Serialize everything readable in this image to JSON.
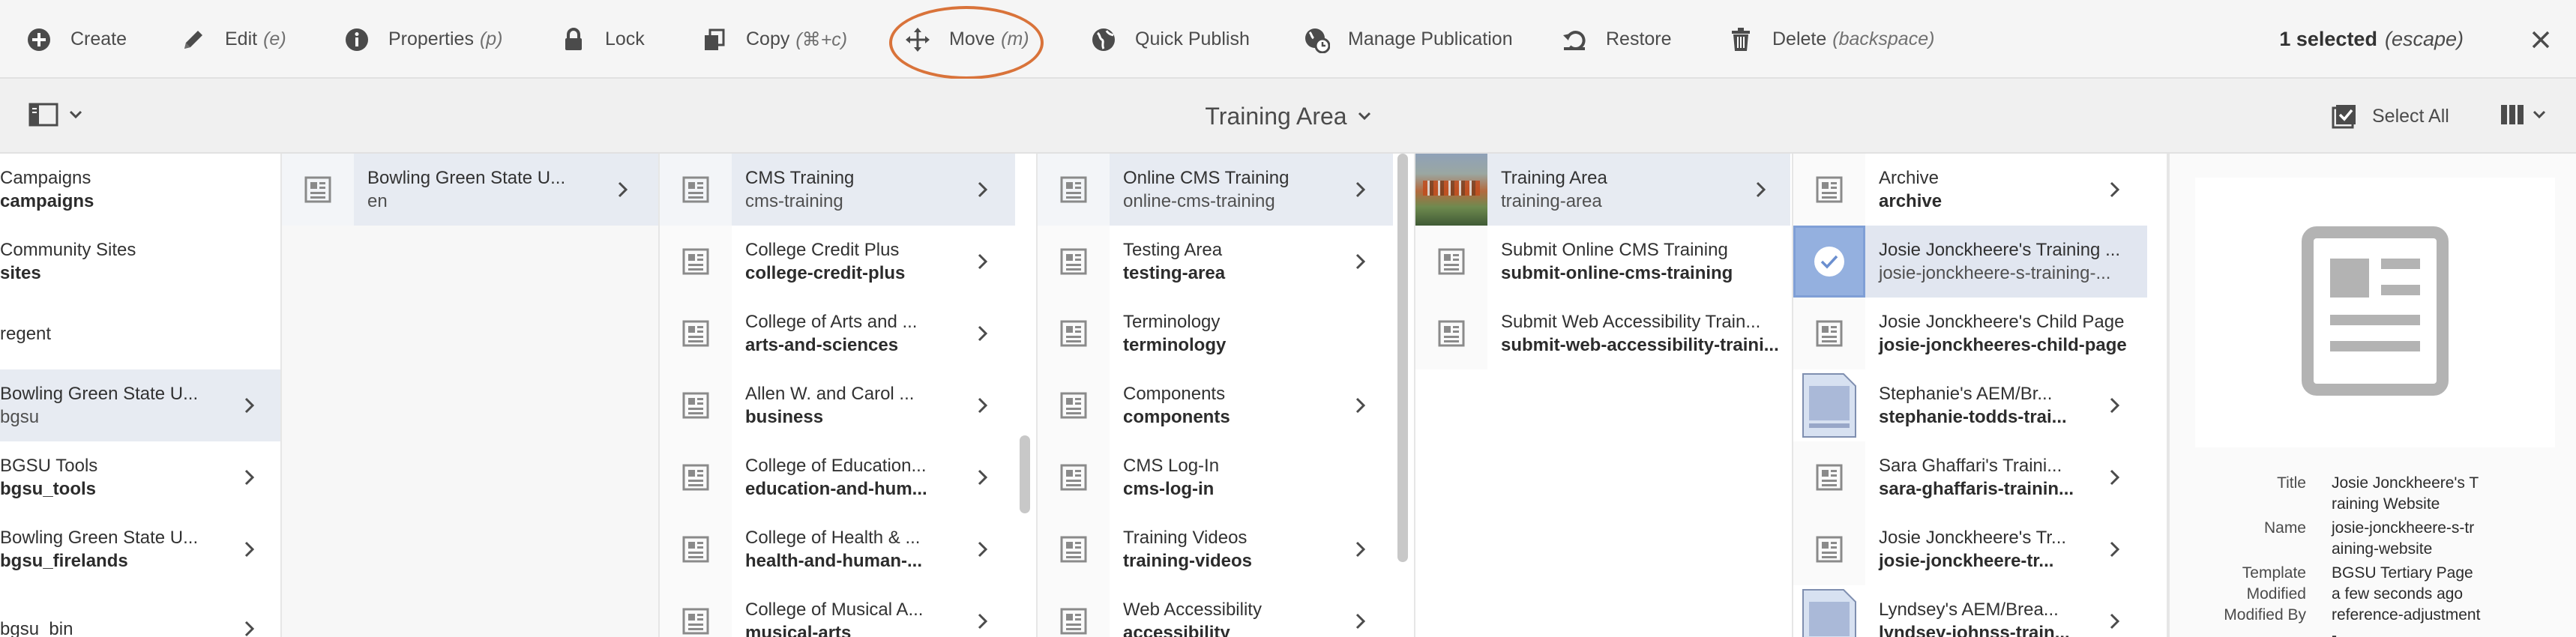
{
  "actions": {
    "create": "Create",
    "edit": "Edit",
    "edit_shortcut": "(e)",
    "properties": "Properties",
    "properties_shortcut": "(p)",
    "lock": "Lock",
    "copy": "Copy",
    "copy_shortcut": "(⌘+c)",
    "move": "Move",
    "move_shortcut": "(m)",
    "quick_publish": "Quick Publish",
    "manage_publication": "Manage Publication",
    "restore": "Restore",
    "delete": "Delete",
    "delete_shortcut": "(backspace)"
  },
  "selection": {
    "count": "1 selected",
    "shortcut": "(escape)"
  },
  "titlebar": {
    "title": "Training Area",
    "select_all": "Select All"
  },
  "columns": {
    "c1": [
      {
        "t1": "Campaigns",
        "t2": "campaigns",
        "chevron": false
      },
      {
        "t1": "Community Sites",
        "t2": "sites",
        "chevron": false
      },
      {
        "t1": "regent",
        "t2": "",
        "chevron": false
      },
      {
        "t1": "Bowling Green State U...",
        "t2": "bgsu",
        "chevron": true,
        "active": true
      },
      {
        "t1": "BGSU Tools",
        "t2": "bgsu_tools",
        "chevron": true
      },
      {
        "t1": "Bowling Green State U...",
        "t2": "bgsu_firelands",
        "chevron": true
      },
      {
        "t1": "bgsu_bin",
        "t2": "",
        "chevron": true
      }
    ],
    "c2": [
      {
        "t1": "Bowling Green State U...",
        "t2": "en",
        "chevron": true,
        "active": true
      }
    ],
    "c3": [
      {
        "t1": "CMS Training",
        "t2": "cms-training",
        "chevron": true,
        "active": true
      },
      {
        "t1": "College Credit Plus",
        "t2": "college-credit-plus",
        "chevron": true
      },
      {
        "t1": "College of Arts and ...",
        "t2": "arts-and-sciences",
        "chevron": true
      },
      {
        "t1": "Allen W. and Carol ...",
        "t2": "business",
        "chevron": true
      },
      {
        "t1": "College of Education...",
        "t2": "education-and-hum...",
        "chevron": true
      },
      {
        "t1": "College of Health & ...",
        "t2": "health-and-human-...",
        "chevron": true
      },
      {
        "t1": "College of Musical A...",
        "t2": "musical-arts",
        "chevron": true
      }
    ],
    "c4": [
      {
        "t1": "Online CMS Training",
        "t2": "online-cms-training",
        "chevron": true,
        "active": true
      },
      {
        "t1": "Testing Area",
        "t2": "testing-area",
        "chevron": true
      },
      {
        "t1": "Terminology",
        "t2": "terminology",
        "chevron": false
      },
      {
        "t1": "Components",
        "t2": "components",
        "chevron": true
      },
      {
        "t1": "CMS Log-In",
        "t2": "cms-log-in",
        "chevron": false
      },
      {
        "t1": "Training Videos",
        "t2": "training-videos",
        "chevron": true
      },
      {
        "t1": "Web Accessibility",
        "t2": "accessibility",
        "chevron": true
      }
    ],
    "c5": [
      {
        "t1": "Training Area",
        "t2": "training-area",
        "chevron": true,
        "active": true,
        "thumb": "photo"
      },
      {
        "t1": "Submit Online CMS Training",
        "t2": "submit-online-cms-training",
        "chevron": false
      },
      {
        "t1": "Submit Web Accessibility Train...",
        "t2": "submit-web-accessibility-traini...",
        "chevron": false
      }
    ],
    "c6": [
      {
        "t1": "Archive",
        "t2": "archive",
        "chevron": true
      },
      {
        "t1": "Josie Jonckheere's Training ...",
        "t2": "josie-jonckheere-s-training-...",
        "chevron": false,
        "selected": true,
        "thumb": "check"
      },
      {
        "t1": "Josie Jonckheere's Child Page",
        "t2": "josie-jonckheeres-child-page",
        "chevron": false
      },
      {
        "t1": "Stephanie's AEM/Br...",
        "t2": "stephanie-todds-trai...",
        "chevron": true,
        "thumb": "doc"
      },
      {
        "t1": "Sara Ghaffari's Traini...",
        "t2": "sara-ghaffaris-trainin...",
        "chevron": true
      },
      {
        "t1": "Josie Jonckheere's Tr...",
        "t2": "josie-jonckheere-tr...",
        "chevron": true
      },
      {
        "t1": "Lyndsey's AEM/Brea...",
        "t2": "lyndsey-johnss-train...",
        "chevron": true,
        "thumb": "doc"
      }
    ]
  },
  "details": {
    "title_label": "Title",
    "title_value": "Josie Jonckheere's Training Website",
    "name_label": "Name",
    "name_value": "josie-jonckheere-s-training-website",
    "template_label": "Template",
    "template_value": "BGSU Tertiary Page",
    "modified_label": "Modified",
    "modified_value": "a few seconds ago",
    "modified_by_label": "Modified By",
    "modified_by_value": "reference-adjustment-"
  },
  "colors": {
    "accent": "#d9733a",
    "selected": "#94b0df",
    "active_row": "#e7ebf2"
  },
  "icons": {
    "create": "plus-circle-icon",
    "edit": "pencil-icon",
    "properties": "info-icon",
    "lock": "lock-icon",
    "copy": "copy-icon",
    "move": "move-arrows-icon",
    "quick_publish": "globe-icon",
    "manage_publication": "globe-clock-icon",
    "restore": "undo-icon",
    "delete": "trash-icon"
  }
}
